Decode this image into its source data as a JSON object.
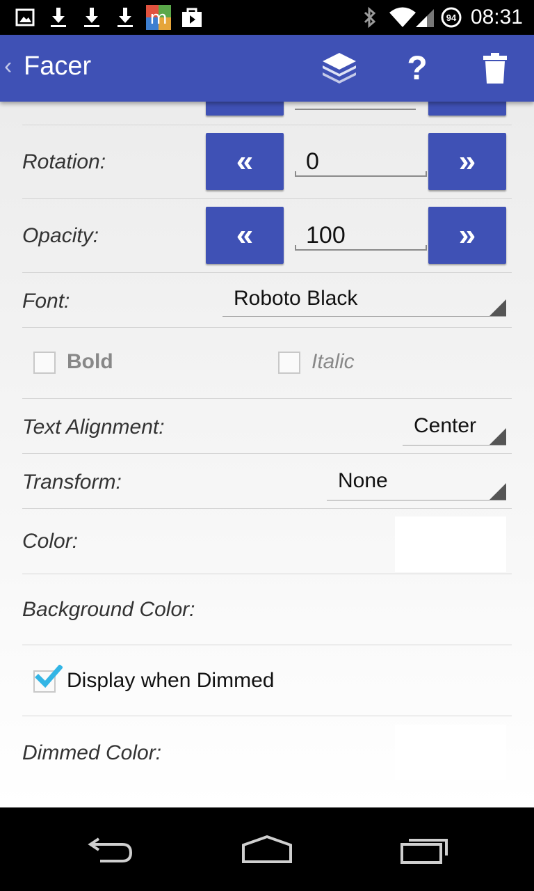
{
  "status_bar": {
    "time": "08:31",
    "battery_level": "94",
    "icons": [
      "image-notification-icon",
      "download-icon",
      "download-icon",
      "download-icon",
      "app-m-icon",
      "play-store-icon",
      "bluetooth-icon",
      "wifi-icon",
      "signal-icon",
      "battery-icon"
    ]
  },
  "action_bar": {
    "back_glyph": "‹",
    "title": "Facer",
    "actions": [
      "layers-icon",
      "help-icon",
      "delete-icon"
    ],
    "help_glyph": "?"
  },
  "form": {
    "stepper_dec": "«",
    "stepper_inc": "»",
    "rotation": {
      "label": "Rotation:",
      "value": "0"
    },
    "opacity": {
      "label": "Opacity:",
      "value": "100"
    },
    "font": {
      "label": "Font:",
      "value": "Roboto Black"
    },
    "bold": {
      "label": "Bold",
      "checked": false
    },
    "italic": {
      "label": "Italic",
      "checked": false
    },
    "text_alignment": {
      "label": "Text Alignment:",
      "value": "Center"
    },
    "transform": {
      "label": "Transform:",
      "value": "None"
    },
    "color": {
      "label": "Color:",
      "swatch": "#ffffff"
    },
    "background_color": {
      "label": "Background Color:"
    },
    "display_when_dimmed": {
      "label": "Display when Dimmed",
      "checked": true
    },
    "dimmed_color": {
      "label": "Dimmed Color:",
      "swatch": "#ffffff"
    }
  },
  "colors": {
    "primary": "#3f51b5",
    "checkbox_accent": "#33b5e5"
  }
}
